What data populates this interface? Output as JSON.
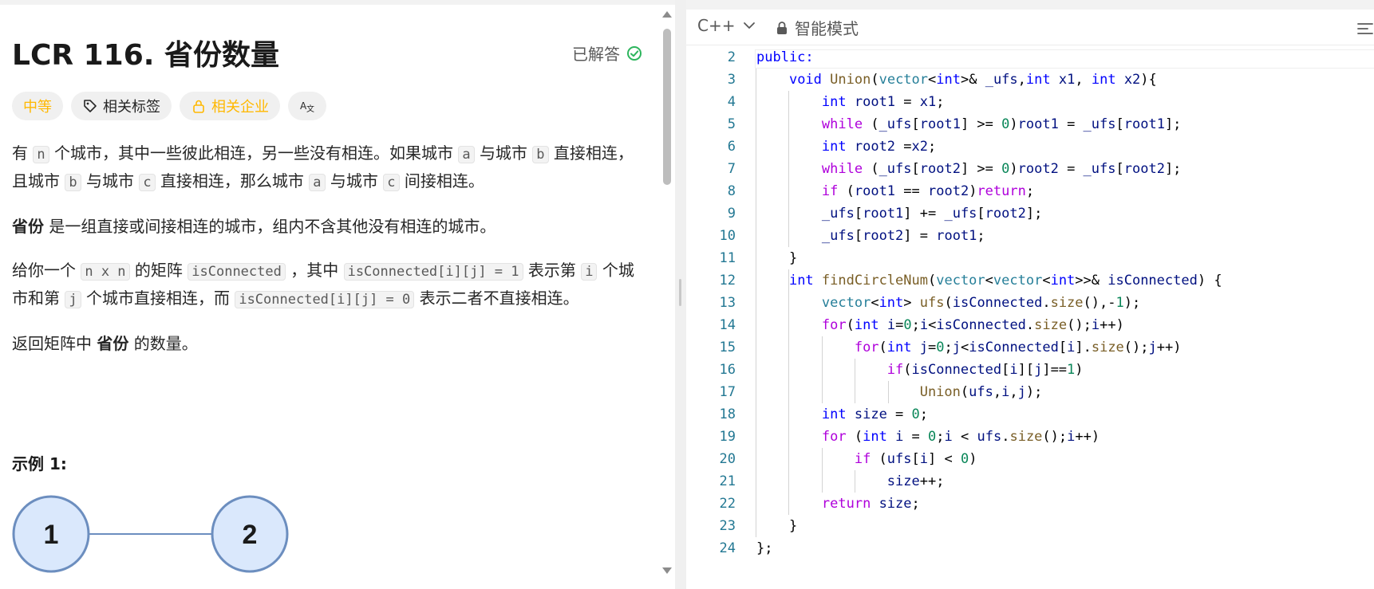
{
  "problem": {
    "title": "LCR 116. 省份数量",
    "solved_label": "已解答",
    "tags": [
      {
        "label": "中等"
      },
      {
        "label": "相关标签"
      },
      {
        "label": "相关企业"
      }
    ],
    "translate_icon": "translate-icon",
    "description": {
      "p1": {
        "s1": "有",
        "c1": "n",
        "s2": "个城市，其中一些彼此相连，另一些没有相连。如果城市",
        "c2": "a",
        "s3": "与城市",
        "c3": "b",
        "s4": "直接相连，且城市",
        "c4": "b",
        "s5": "与城市",
        "c5": "c",
        "s6": "直接相连，那么城市",
        "c6": "a",
        "s7": "与城市",
        "c7": "c",
        "s8": "间接相连。"
      },
      "p2": {
        "bold": "省份",
        "rest": "是一组直接或间接相连的城市，组内不含其他没有相连的城市。"
      },
      "p3": {
        "s1": "给你一个",
        "c1": "n x n",
        "s2": "的矩阵",
        "c2": "isConnected",
        "s3": "，其中",
        "c3": "isConnected[i][j] = 1",
        "s4": "表示第",
        "c4": "i",
        "s5": "个城市和第",
        "c5": "j",
        "s6": "个城市直接相连，而",
        "c6": "isConnected[i][j] = 0",
        "s7": "表示二者不直接相连。"
      },
      "p4": {
        "s1": "返回矩阵中",
        "bold": "省份",
        "s2": "的数量。"
      }
    },
    "example_title": "示例 1:",
    "example_nodes": [
      "1",
      "2"
    ]
  },
  "editor": {
    "language": "C++",
    "mode_label": "智能模式",
    "line_numbers": [
      "2",
      "3",
      "4",
      "5",
      "6",
      "7",
      "8",
      "9",
      "10",
      "11",
      "12",
      "13",
      "14",
      "15",
      "16",
      "17",
      "18",
      "19",
      "20",
      "21",
      "22",
      "23",
      "24"
    ]
  },
  "colors": {
    "accent_orange": "#ffb800",
    "solved_green": "#2db55d",
    "keyword_blue": "#0000ff",
    "node_fill": "#dae8fc",
    "node_stroke": "#6c8ebf"
  }
}
